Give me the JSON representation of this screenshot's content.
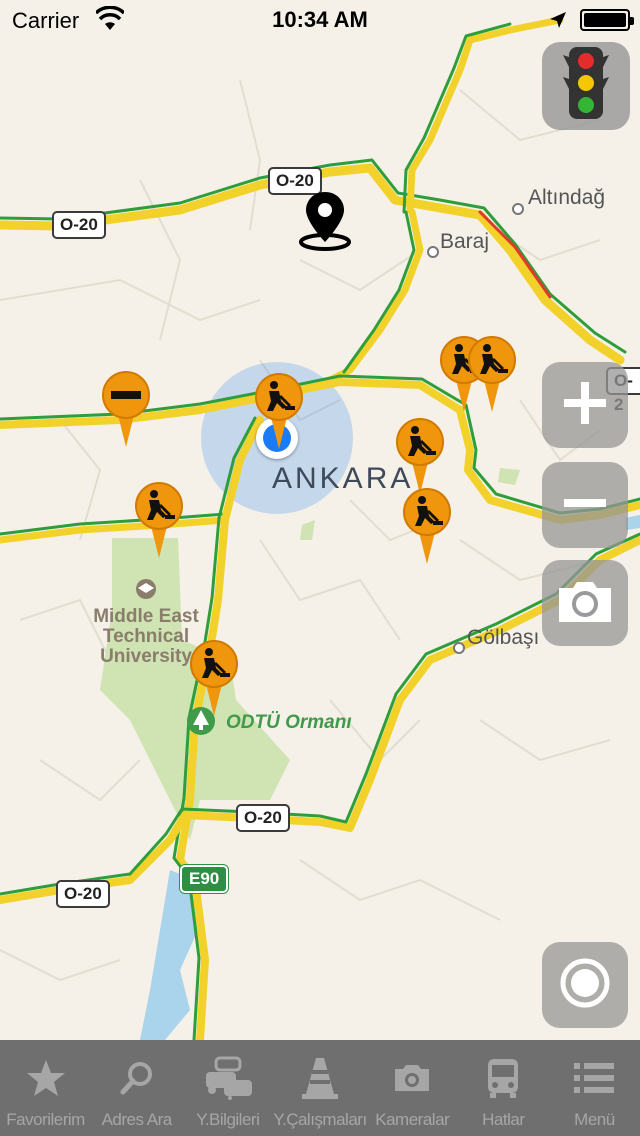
{
  "status_bar": {
    "carrier": "Carrier",
    "time": "10:34 AM"
  },
  "map": {
    "city_label": "ANKARA",
    "places": [
      {
        "name": "Altındağ"
      },
      {
        "name": "Baraj"
      },
      {
        "name": "Gölbaşı"
      }
    ],
    "university_label_lines": [
      "Middle East",
      "Technical",
      "University"
    ],
    "forest_label": "ODTÜ Ormanı",
    "road_shields": [
      "O-20",
      "O-20",
      "O-20",
      "O-20",
      "O-2"
    ],
    "euro_shield": "E90",
    "colors": {
      "land": "#f5f1e8",
      "park": "#cfe3b3",
      "water": "#a9d4ec",
      "traffic_green": "#2e9e3a",
      "traffic_yellow": "#f2d22a",
      "traffic_red": "#e03a2a",
      "pin_orange": "#f0960c",
      "user_location": "#1a7cf5"
    }
  },
  "controls": {
    "traffic_icon": "traffic-light-icon",
    "zoom_in": "+",
    "zoom_out": "−",
    "camera_icon": "camera-icon",
    "locate_icon": "locate-icon"
  },
  "tabs": [
    {
      "label": "Favorilerim",
      "icon": "star-icon"
    },
    {
      "label": "Adres Ara",
      "icon": "search-icon"
    },
    {
      "label": "Y.Bilgileri",
      "icon": "cars-icon"
    },
    {
      "label": "Y.Çalışmaları",
      "icon": "cone-icon"
    },
    {
      "label": "Kameralar",
      "icon": "camera-icon"
    },
    {
      "label": "Hatlar",
      "icon": "bus-icon"
    },
    {
      "label": "Menü",
      "icon": "list-icon"
    }
  ]
}
